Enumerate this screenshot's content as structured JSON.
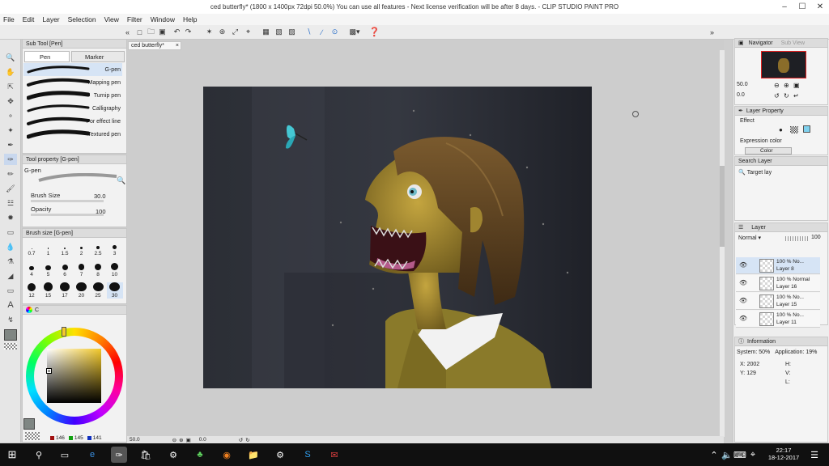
{
  "window": {
    "title": "ced butterfly* (1800 x 1400px 72dpi 50.0%)  You can use all features - Next license verification will be after 8 days. - CLIP STUDIO PAINT PRO",
    "minimize": "–",
    "maximize": "☐",
    "close": "✕"
  },
  "menu": [
    "File",
    "Edit",
    "Layer",
    "Selection",
    "View",
    "Filter",
    "Window",
    "Help"
  ],
  "subtool": {
    "header": "Sub Tool [Pen]",
    "tabs": [
      "Pen",
      "Marker"
    ],
    "brushes": [
      "G-pen",
      "Mapping pen",
      "Turnip pen",
      "Calligraphy",
      "For effect line",
      "Textured pen"
    ]
  },
  "tool_property": {
    "header": "Tool property [G-pen]",
    "name": "G-pen",
    "brush_size_label": "Brush Size",
    "brush_size_value": "30.0",
    "opacity_label": "Opacity",
    "opacity_value": "100"
  },
  "brush_size_palette": {
    "header": "Brush size [G-pen]",
    "sizes": [
      "0.7",
      "1",
      "1.5",
      "2",
      "2.5",
      "3",
      "4",
      "5",
      "6",
      "7",
      "8",
      "10",
      "12",
      "15",
      "17",
      "20",
      "25",
      "30"
    ]
  },
  "color": {
    "tab_label": "C",
    "r": "146",
    "g": "145",
    "b": "141",
    "main_color": "#7f8683",
    "hue_color": "#f2c82a"
  },
  "canvas": {
    "tab_label": "ced butterfly*",
    "zoom": "50.0",
    "rotation": "0.0"
  },
  "navigator": {
    "tabs": [
      "Navigator",
      "Sub View"
    ],
    "zoom": "50.0",
    "rotation": "0.0"
  },
  "layer_property": {
    "header": "Layer Property",
    "effect_label": "Effect",
    "expression_label": "Expression color",
    "color_dropdown": "Color"
  },
  "search_layer": {
    "header": "Search Layer",
    "target": "Target lay"
  },
  "layers": {
    "header": "Layer",
    "blend_mode": "Normal",
    "opacity": "100",
    "items": [
      {
        "opacity": "100 %",
        "mode": "No...",
        "name": "Layer 8"
      },
      {
        "opacity": "100 %",
        "mode": "Normal",
        "name": "Layer 16"
      },
      {
        "opacity": "100 %",
        "mode": "No...",
        "name": "Layer 15"
      },
      {
        "opacity": "100 %",
        "mode": "No...",
        "name": "Layer 11"
      }
    ]
  },
  "information": {
    "header": "Information",
    "system": "System: 50%",
    "application": "Application: 19%",
    "x_label": "X:",
    "x_value": "2002",
    "y_label": "Y:",
    "y_value": "129",
    "h_label": "H:",
    "v_label": "V:",
    "l_label": "L:"
  },
  "taskbar": {
    "time": "22:17",
    "date": "18-12-2017"
  }
}
